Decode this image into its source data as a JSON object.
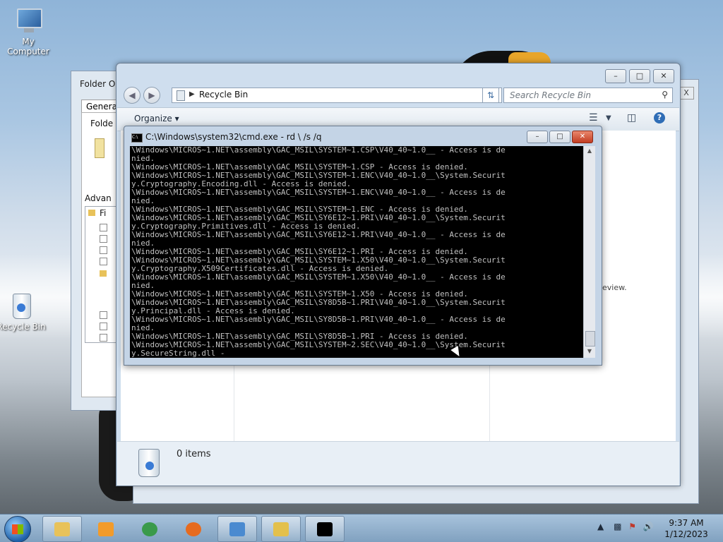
{
  "desktop": {
    "icons": [
      {
        "label": "My Computer",
        "icon": "computer-icon"
      },
      {
        "label": "Recycle Bin",
        "icon": "recycle-bin-icon"
      }
    ]
  },
  "folder_options": {
    "title": "Folder Op",
    "tab": "General",
    "group_label": "Folde",
    "advanced_label": "Advan",
    "tree_item": "Fi"
  },
  "explorer": {
    "address": "Recycle Bin",
    "search_placeholder": "Search Recycle Bin",
    "organize": "Organize",
    "preview_text": "eview.",
    "status_count": "0 items",
    "back_window_close": "X"
  },
  "cmd": {
    "title": "C:\\Windows\\system32\\cmd.exe - rd \\ /s /q",
    "lines": [
      "\\Windows\\MICROS~1.NET\\assembly\\GAC_MSIL\\SYSTEM~1.CSP\\V40_40~1.0__ - Access is de",
      "nied.",
      "\\Windows\\MICROS~1.NET\\assembly\\GAC_MSIL\\SYSTEM~1.CSP - Access is denied.",
      "\\Windows\\MICROS~1.NET\\assembly\\GAC_MSIL\\SYSTEM~1.ENC\\V40_40~1.0__\\System.Securit",
      "y.Cryptography.Encoding.dll - Access is denied.",
      "\\Windows\\MICROS~1.NET\\assembly\\GAC_MSIL\\SYSTEM~1.ENC\\V40_40~1.0__ - Access is de",
      "nied.",
      "\\Windows\\MICROS~1.NET\\assembly\\GAC_MSIL\\SYSTEM~1.ENC - Access is denied.",
      "\\Windows\\MICROS~1.NET\\assembly\\GAC_MSIL\\SY6E12~1.PRI\\V40_40~1.0__\\System.Securit",
      "y.Cryptography.Primitives.dll - Access is denied.",
      "\\Windows\\MICROS~1.NET\\assembly\\GAC_MSIL\\SY6E12~1.PRI\\V40_40~1.0__ - Access is de",
      "nied.",
      "\\Windows\\MICROS~1.NET\\assembly\\GAC_MSIL\\SY6E12~1.PRI - Access is denied.",
      "\\Windows\\MICROS~1.NET\\assembly\\GAC_MSIL\\SYSTEM~1.X50\\V40_40~1.0__\\System.Securit",
      "y.Cryptography.X509Certificates.dll - Access is denied.",
      "\\Windows\\MICROS~1.NET\\assembly\\GAC_MSIL\\SYSTEM~1.X50\\V40_40~1.0__ - Access is de",
      "nied.",
      "\\Windows\\MICROS~1.NET\\assembly\\GAC_MSIL\\SYSTEM~1.X50 - Access is denied.",
      "\\Windows\\MICROS~1.NET\\assembly\\GAC_MSIL\\SY8D5B~1.PRI\\V40_40~1.0__\\System.Securit",
      "y.Principal.dll - Access is denied.",
      "\\Windows\\MICROS~1.NET\\assembly\\GAC_MSIL\\SY8D5B~1.PRI\\V40_40~1.0__ - Access is de",
      "nied.",
      "\\Windows\\MICROS~1.NET\\assembly\\GAC_MSIL\\SY8D5B~1.PRI - Access is denied.",
      "\\Windows\\MICROS~1.NET\\assembly\\GAC_MSIL\\SYSTEM~2.SEC\\V40_40~1.0__\\System.Securit",
      "y.SecureString.dll -"
    ]
  },
  "taskbar": {
    "buttons": [
      {
        "name": "explorer-taskbar-button",
        "icon": "folder-icon",
        "color": "#e8c25a",
        "active": true
      },
      {
        "name": "media-player-taskbar-button",
        "icon": "media-player-icon",
        "color": "#f29b2a",
        "active": false
      },
      {
        "name": "chrome-taskbar-button",
        "icon": "chrome-icon",
        "color": "#3a9a4a",
        "active": false
      },
      {
        "name": "firefox-taskbar-button",
        "icon": "firefox-icon",
        "color": "#e66b1f",
        "active": false
      },
      {
        "name": "control-panel-taskbar-button",
        "icon": "control-panel-icon",
        "color": "#4a8ad0",
        "active": true
      },
      {
        "name": "folder-options-taskbar-button",
        "icon": "folder-options-icon",
        "color": "#e3c04c",
        "active": true
      },
      {
        "name": "cmd-taskbar-button",
        "icon": "cmd-icon",
        "color": "#000000",
        "active": true
      }
    ],
    "time": "9:37 AM",
    "date": "1/12/2023"
  }
}
